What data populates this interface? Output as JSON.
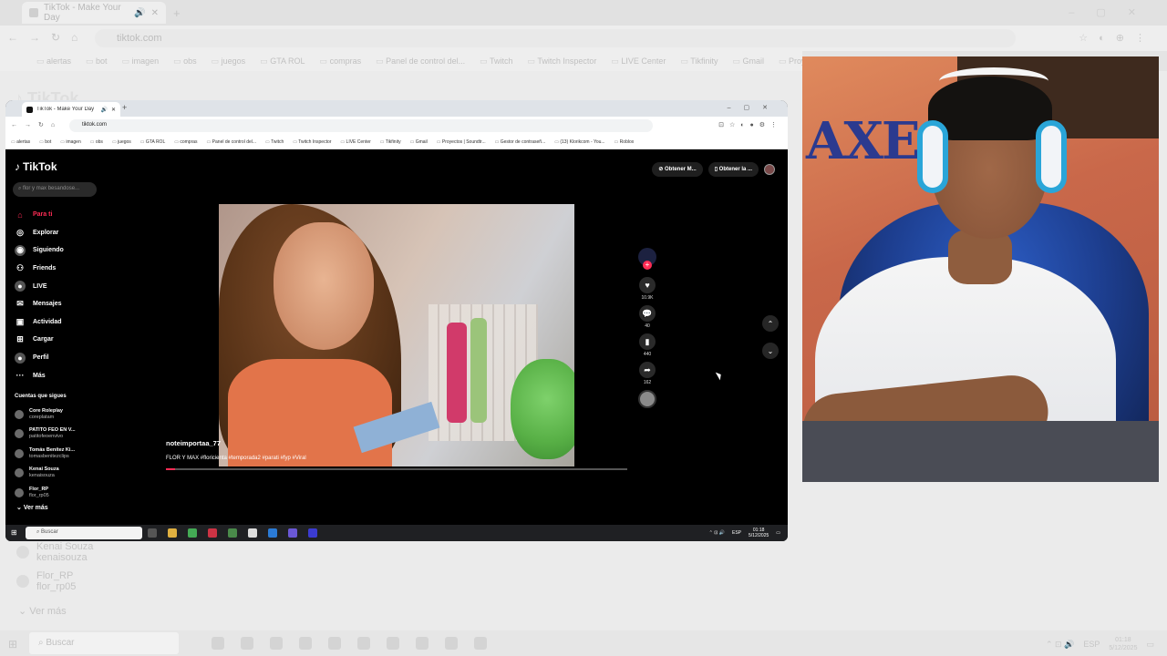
{
  "outer": {
    "tab_title": "TikTok - Make Your Day",
    "url": "tiktok.com",
    "bookmarks": [
      "alertas",
      "bot",
      "imagen",
      "obs",
      "juegos",
      "GTA ROL",
      "compras",
      "Panel de control del...",
      "Twitch",
      "Twitch Inspector",
      "LIVE Center",
      "Tikfinity",
      "Gmail",
      "Proyectos |"
    ],
    "following": [
      {
        "name": "Kenai Souza",
        "handle": "kenaisouza"
      },
      {
        "name": "Flor_RP",
        "handle": "flor_rp05"
      }
    ],
    "ver_mas": "Ver más",
    "taskbar": {
      "search_placeholder": "Buscar",
      "lang": "ESP",
      "time": "01:18",
      "date": "5/12/2025"
    }
  },
  "inner": {
    "tab_title": "TikTok - Make Your Day",
    "url": "tiktok.com",
    "bookmarks": [
      "alertas",
      "bot",
      "imagen",
      "obs",
      "juegos",
      "GTA ROL",
      "compras",
      "Panel de control del...",
      "Twitch",
      "Twitch Inspector",
      "LIVE Center",
      "Tikfinity",
      "Gmail",
      "Proyectos | Soundtr...",
      "Gestor de contraseñ...",
      "(13) Klorikcom - You...",
      "Roblox"
    ]
  },
  "tiktok": {
    "logo": "TikTok",
    "search_placeholder": "flor y max besandose...",
    "nav": [
      {
        "label": "Para ti",
        "icon": "home-icon",
        "glyph": "⌂"
      },
      {
        "label": "Explorar",
        "icon": "compass-icon",
        "glyph": "◎"
      },
      {
        "label": "Siguiendo",
        "icon": "following-icon",
        "glyph": "◉"
      },
      {
        "label": "Friends",
        "icon": "friends-icon",
        "glyph": "⚇"
      },
      {
        "label": "LIVE",
        "icon": "live-icon",
        "glyph": "●"
      },
      {
        "label": "Mensajes",
        "icon": "messages-icon",
        "glyph": "✉"
      },
      {
        "label": "Actividad",
        "icon": "activity-icon",
        "glyph": "▣"
      },
      {
        "label": "Cargar",
        "icon": "upload-icon",
        "glyph": "⊞"
      },
      {
        "label": "Perfil",
        "icon": "profile-icon",
        "glyph": "●"
      },
      {
        "label": "Más",
        "icon": "more-icon",
        "glyph": "···"
      }
    ],
    "following_title": "Cuentas que sigues",
    "following": [
      {
        "name": "Core Roleplay",
        "handle": "coreplatam"
      },
      {
        "name": "PATITO FEO EN V...",
        "handle": "patitofeoenvivo"
      },
      {
        "name": "Tomás Benítez Ki...",
        "handle": "tomasbenitezclips"
      },
      {
        "name": "Kenai Souza",
        "handle": "kenaisouza"
      },
      {
        "name": "Flor_RP",
        "handle": "flor_rp05"
      }
    ],
    "ver_mas": "Ver más",
    "obtener_app": "Obtener M...",
    "obtener_pc": "Obtener la ...",
    "video": {
      "username": "noteimportaa_77",
      "description": "FLOR Y MAX #floricienta #temporada2 #parati #fyp #Viral",
      "progress": 0.02
    },
    "actions": [
      {
        "icon": "heart-icon",
        "glyph": "♥",
        "count": "10.9K"
      },
      {
        "icon": "comment-icon",
        "glyph": "💬",
        "count": "40"
      },
      {
        "icon": "bookmark-icon",
        "glyph": "▮",
        "count": "440"
      },
      {
        "icon": "share-icon",
        "glyph": "➦",
        "count": "162"
      }
    ]
  },
  "inner_taskbar": {
    "search_placeholder": "Buscar",
    "lang": "ESP",
    "time": "01:18",
    "date": "5/12/2025"
  },
  "colors": {
    "tiktok_accent": "#fe2c55",
    "app_bg": "#000000",
    "chair_blue": "#2d5fc8",
    "headphone_accent": "#2aa5d8"
  }
}
